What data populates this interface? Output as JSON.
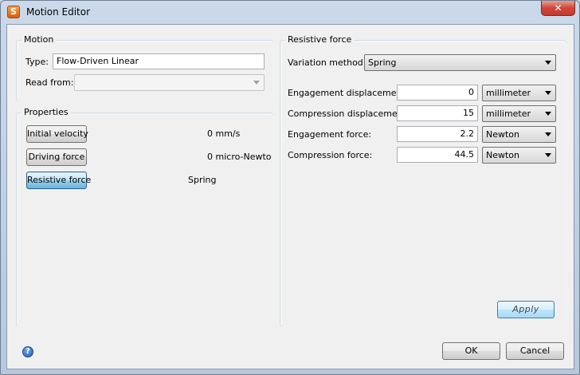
{
  "window": {
    "title": "Motion Editor",
    "close_glyph": "✕",
    "app_icon_glyph": "S"
  },
  "motion": {
    "group_title": "Motion",
    "type_label": "Type:",
    "type_value": "Flow-Driven Linear",
    "read_from_label": "Read from:",
    "read_from_value": ""
  },
  "properties": {
    "group_title": "Properties",
    "rows": [
      {
        "button": "Initial velocity",
        "value": "0 mm/s"
      },
      {
        "button": "Driving force",
        "value": "0 micro-Newto"
      },
      {
        "button": "Resistive force",
        "value": "Spring"
      }
    ]
  },
  "resistive_force": {
    "group_title": "Resistive force",
    "variation_label": "Variation method:",
    "variation_value": "Spring",
    "fields": [
      {
        "label": "Engagement displacement:",
        "value": "0",
        "unit": "millimeter"
      },
      {
        "label": "Compression displacement:",
        "value": "15",
        "unit": "millimeter"
      },
      {
        "label": "Engagement force:",
        "value": "2.2",
        "unit": "Newton"
      },
      {
        "label": "Compression force:",
        "value": "44.5",
        "unit": "Newton"
      }
    ],
    "apply_label": "Apply"
  },
  "footer": {
    "help_glyph": "?",
    "ok_label": "OK",
    "cancel_label": "Cancel"
  },
  "icons": [
    "app-icon",
    "close-icon",
    "help-icon",
    "chevron-down-icon"
  ]
}
